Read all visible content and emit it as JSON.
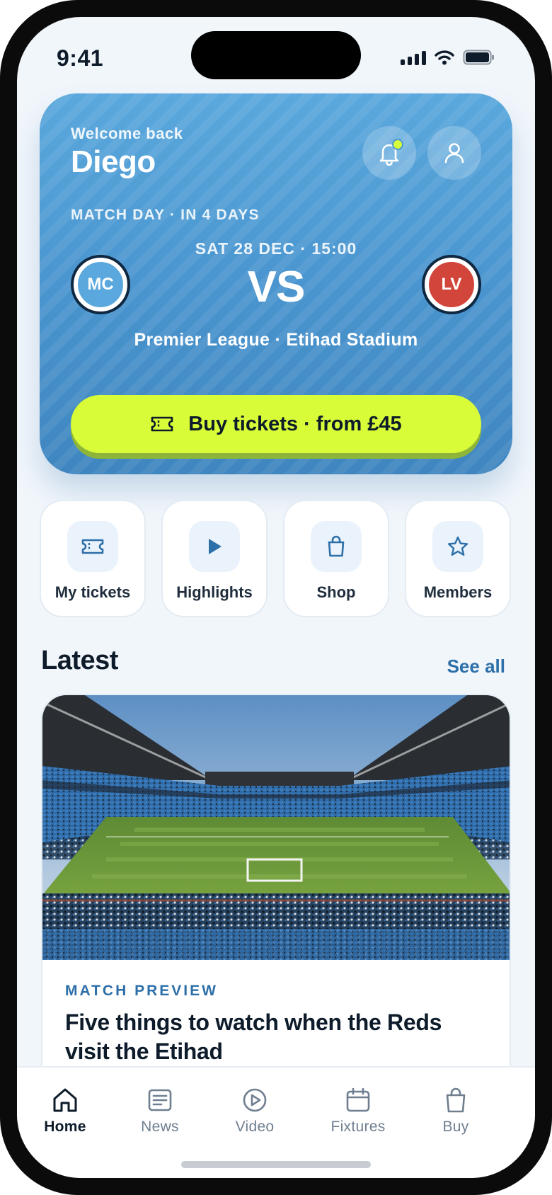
{
  "status_bar": {
    "time": "9:41"
  },
  "hero": {
    "welcome": "Welcome back",
    "username": "Diego",
    "match_day": "MATCH DAY · IN 4 DAYS",
    "kickoff": "SAT 28 DEC · 15:00",
    "vs": "VS",
    "home_team": "MC",
    "away_team": "LV",
    "venue": "Premier League · Etihad Stadium",
    "buy_label": "Buy tickets · from £45",
    "accent_color": "#d8fc38",
    "hero_color": "#4a95cf"
  },
  "quick_actions": [
    {
      "label": "My tickets",
      "icon": "ticket-icon"
    },
    {
      "label": "Highlights",
      "icon": "play-icon"
    },
    {
      "label": "Shop",
      "icon": "bag-icon"
    },
    {
      "label": "Members",
      "icon": "star-icon"
    }
  ],
  "latest": {
    "title": "Latest",
    "see_all": "See all",
    "card": {
      "category": "MATCH PREVIEW",
      "title": "Five things to watch when the Reds visit the Etihad",
      "image": "stadium-photo"
    }
  },
  "tabs": [
    {
      "label": "Home",
      "icon": "home-icon",
      "active": true
    },
    {
      "label": "News",
      "icon": "news-icon",
      "active": false
    },
    {
      "label": "Video",
      "icon": "video-icon",
      "active": false
    },
    {
      "label": "Fixtures",
      "icon": "calendar-icon",
      "active": false
    },
    {
      "label": "Buy",
      "icon": "bag-icon",
      "active": false
    }
  ]
}
